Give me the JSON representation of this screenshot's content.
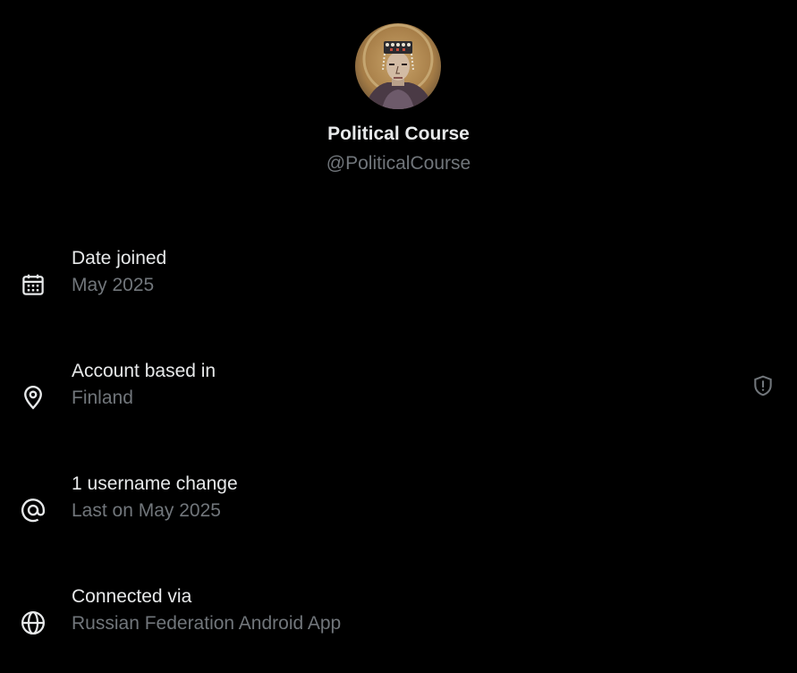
{
  "profile": {
    "display_name": "Political Course",
    "handle": "@PoliticalCourse"
  },
  "rows": [
    {
      "label": "Date joined",
      "value": "May 2025",
      "icon": "calendar-icon"
    },
    {
      "label": "Account based in",
      "value": "Finland",
      "icon": "location-pin-icon",
      "action_icon": "shield-alert-icon"
    },
    {
      "label": "1 username change",
      "value": "Last on May 2025",
      "icon": "at-sign-icon"
    },
    {
      "label": "Connected via",
      "value": "Russian Federation Android App",
      "icon": "globe-icon"
    }
  ],
  "colors": {
    "background": "#000000",
    "primary_text": "#e7e9ea",
    "secondary_text": "#71767b"
  }
}
